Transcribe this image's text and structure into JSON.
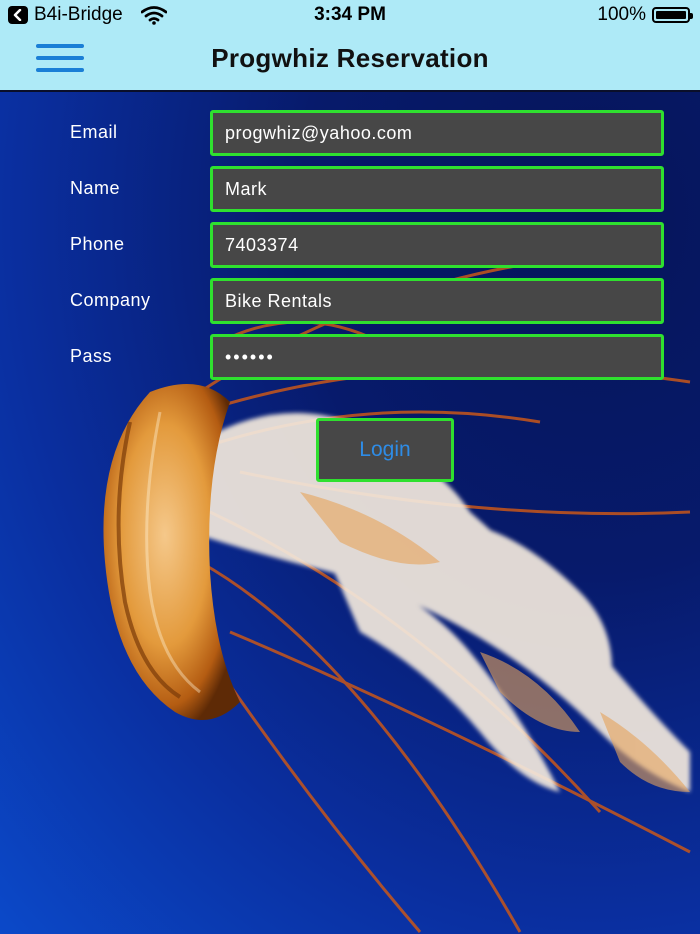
{
  "status_bar": {
    "back_app": "B4i-Bridge",
    "time": "3:34 PM",
    "battery_text": "100%",
    "battery_level": 1.0,
    "icons": [
      "back-arrow-icon",
      "wifi-icon",
      "battery-icon"
    ]
  },
  "nav": {
    "title": "Progwhiz Reservation",
    "menu_icon": "hamburger-menu-icon",
    "accent_color": "#1a7fd6"
  },
  "form": {
    "fields": [
      {
        "label": "Email",
        "value": "progwhiz@yahoo.com"
      },
      {
        "label": "Name",
        "value": "Mark"
      },
      {
        "label": "Phone",
        "value": "7403374"
      },
      {
        "label": "Company",
        "value": "Bike Rentals"
      },
      {
        "label": "Pass",
        "value": "••••••"
      }
    ],
    "login_label": "Login",
    "border_color": "#2fe02f",
    "input_bg": "#474747",
    "button_text_color": "#2e8ce6"
  },
  "theme": {
    "header_bg": "#aeeaf7",
    "background_image": "jellyfish-underwater"
  }
}
